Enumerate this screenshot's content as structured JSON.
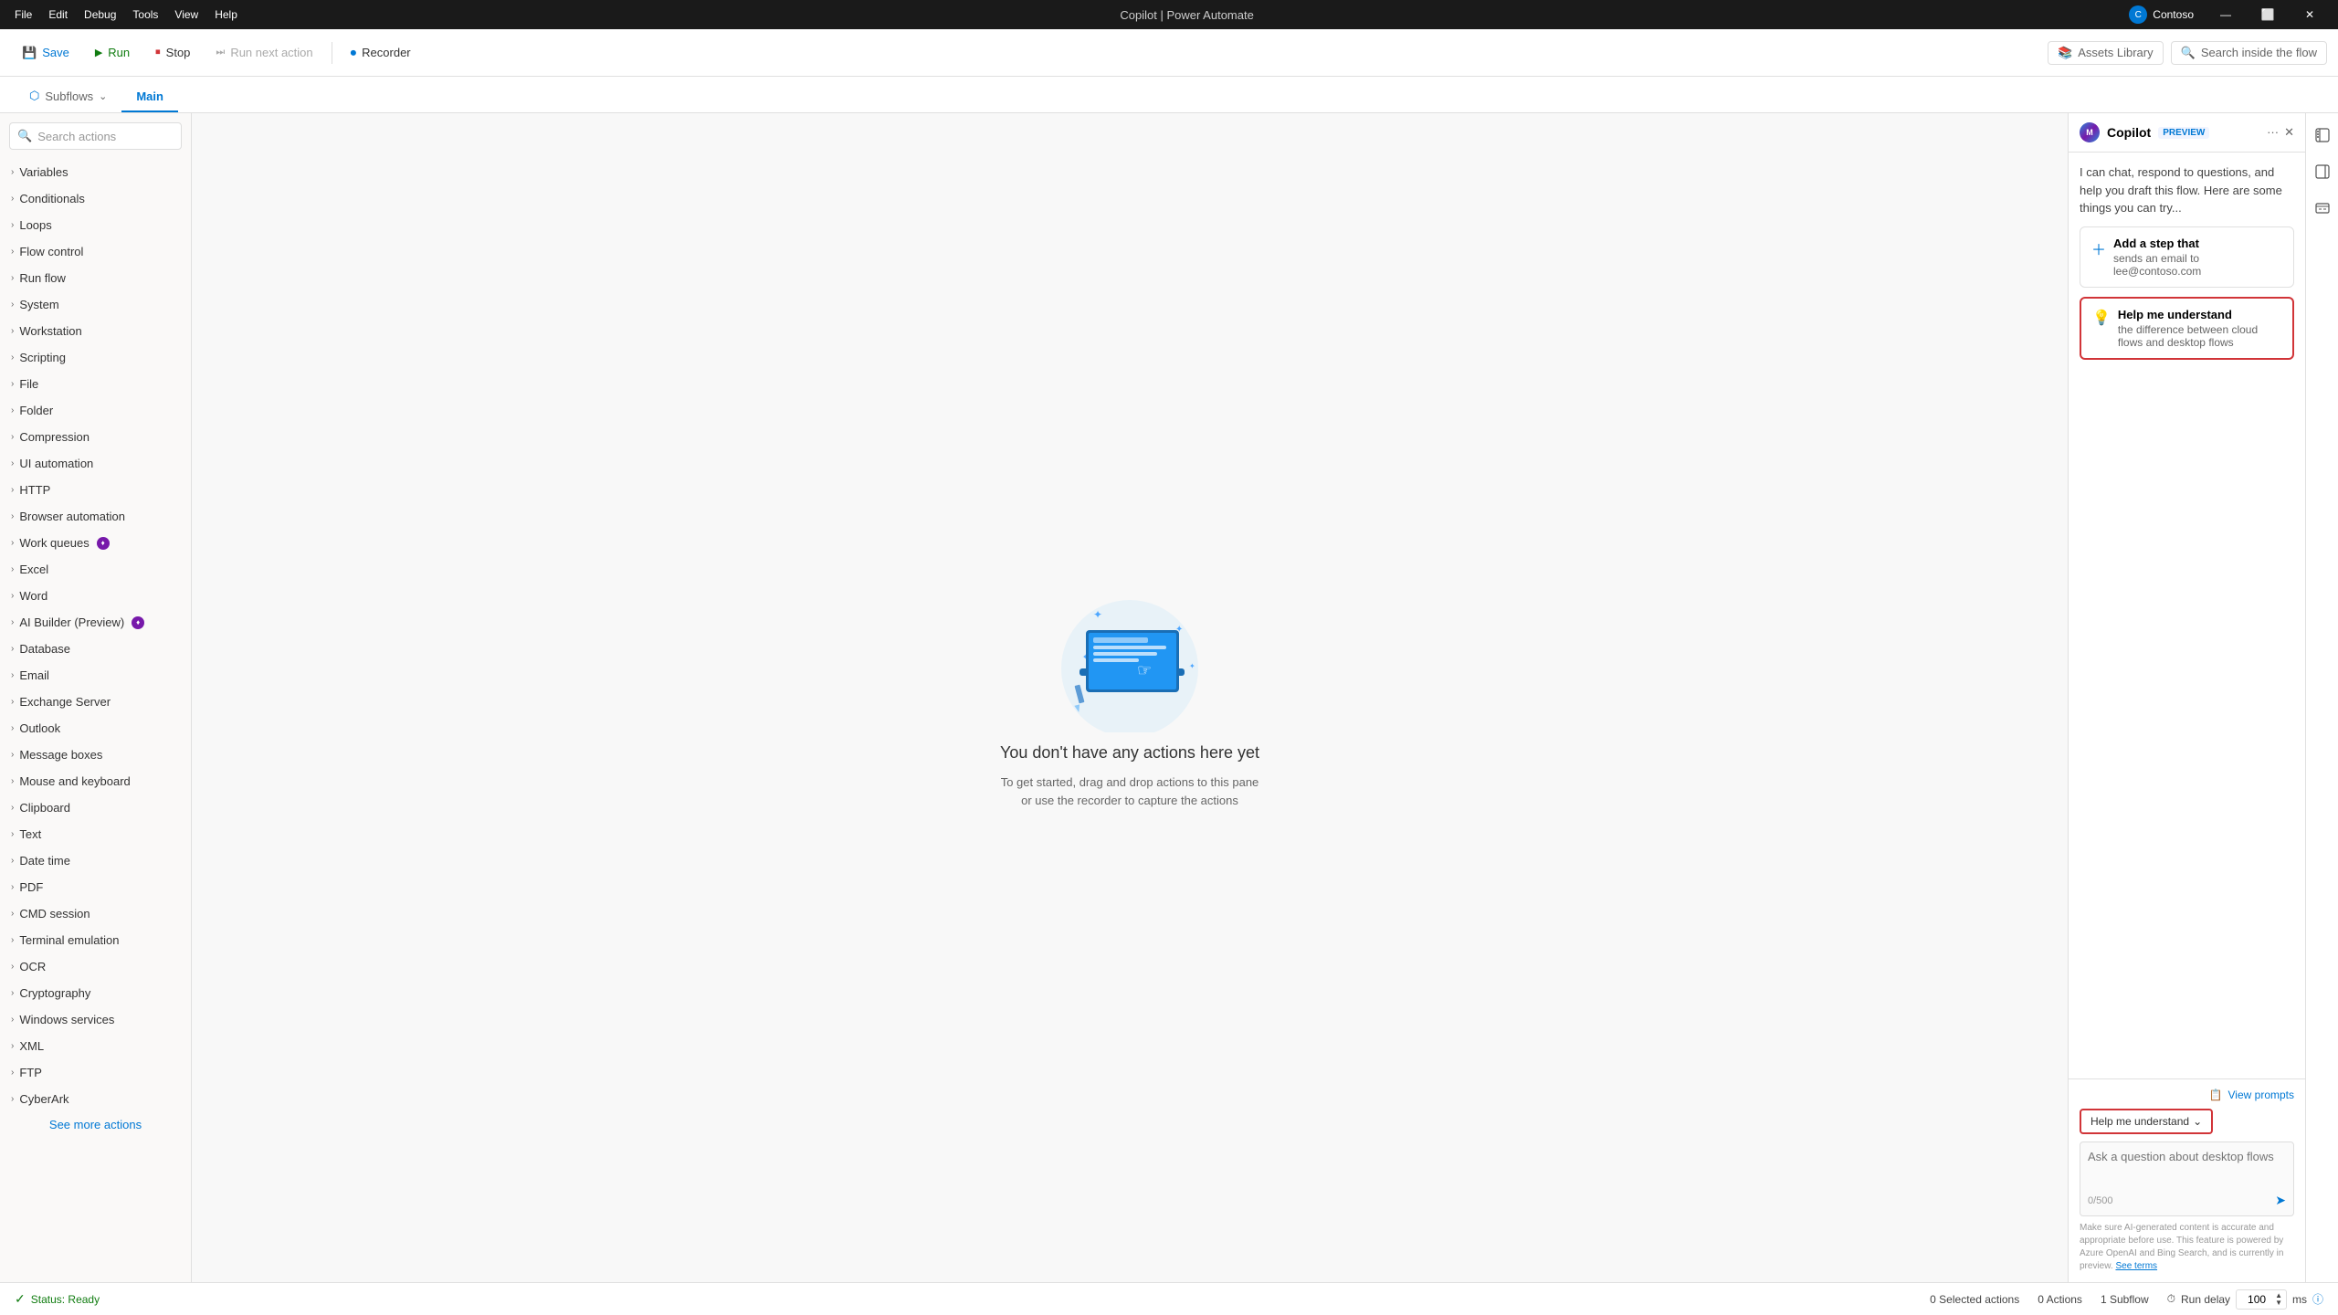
{
  "app": {
    "title": "Copilot | Power Automate"
  },
  "titlebar": {
    "menus": [
      "File",
      "Edit",
      "Debug",
      "Tools",
      "View",
      "Help"
    ],
    "title": "Copilot | Power Automate",
    "user": "Contoso",
    "controls": [
      "—",
      "⬜",
      "✕"
    ]
  },
  "toolbar": {
    "save_label": "Save",
    "run_label": "Run",
    "stop_label": "Stop",
    "next_label": "Run next action",
    "recorder_label": "Recorder",
    "assets_label": "Assets Library",
    "search_label": "Search inside the flow"
  },
  "subtabs": {
    "subflows_label": "Subflows",
    "main_label": "Main"
  },
  "sidebar": {
    "search_placeholder": "Search actions",
    "items": [
      {
        "label": "Variables"
      },
      {
        "label": "Conditionals"
      },
      {
        "label": "Loops"
      },
      {
        "label": "Flow control"
      },
      {
        "label": "Run flow"
      },
      {
        "label": "System"
      },
      {
        "label": "Workstation"
      },
      {
        "label": "Scripting"
      },
      {
        "label": "File"
      },
      {
        "label": "Folder"
      },
      {
        "label": "Compression"
      },
      {
        "label": "UI automation"
      },
      {
        "label": "HTTP"
      },
      {
        "label": "Browser automation"
      },
      {
        "label": "Work queues"
      },
      {
        "label": "Excel"
      },
      {
        "label": "Word"
      },
      {
        "label": "AI Builder (Preview)"
      },
      {
        "label": "Database"
      },
      {
        "label": "Email"
      },
      {
        "label": "Exchange Server"
      },
      {
        "label": "Outlook"
      },
      {
        "label": "Message boxes"
      },
      {
        "label": "Mouse and keyboard"
      },
      {
        "label": "Clipboard"
      },
      {
        "label": "Text"
      },
      {
        "label": "Date time"
      },
      {
        "label": "PDF"
      },
      {
        "label": "CMD session"
      },
      {
        "label": "Terminal emulation"
      },
      {
        "label": "OCR"
      },
      {
        "label": "Cryptography"
      },
      {
        "label": "Windows services"
      },
      {
        "label": "XML"
      },
      {
        "label": "FTP"
      },
      {
        "label": "CyberArk"
      }
    ],
    "see_more": "See more actions"
  },
  "canvas": {
    "empty_title": "You don't have any actions here yet",
    "empty_desc_line1": "To get started, drag and drop actions to this pane",
    "empty_desc_line2": "or use the recorder to capture the actions"
  },
  "copilot": {
    "title": "Copilot",
    "preview_label": "PREVIEW",
    "intro": "I can chat, respond to questions, and help you draft this flow. Here are some things you can try...",
    "suggestions": [
      {
        "icon": "plus",
        "title": "Add a step that",
        "subtitle": "sends an email to lee@contoso.com"
      },
      {
        "icon": "bulb",
        "title": "Help me understand",
        "subtitle": "the difference between cloud flows and desktop flows"
      }
    ],
    "view_prompts": "View prompts",
    "understand_dropdown": "Help me understand",
    "chat_placeholder": "Ask a question about desktop flows",
    "char_count": "0/500",
    "disclaimer": "Make sure AI-generated content is accurate and appropriate before use. This feature is powered by Azure OpenAI and Bing Search, and is currently in preview.",
    "see_terms": "See terms"
  },
  "statusbar": {
    "status": "Status: Ready",
    "selected": "0 Selected actions",
    "actions": "0 Actions",
    "subflow": "1 Subflow",
    "run_delay_label": "Run delay",
    "delay_value": "100",
    "delay_unit": "ms"
  }
}
